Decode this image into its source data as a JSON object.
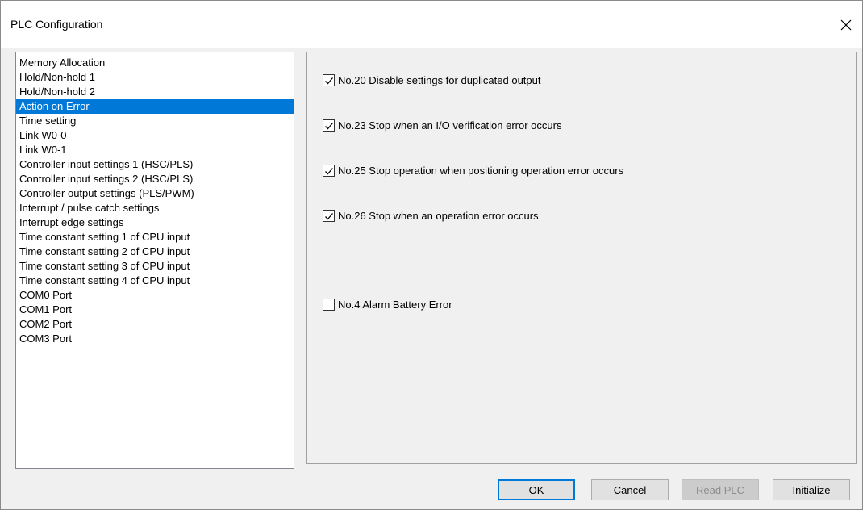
{
  "window": {
    "title": "PLC Configuration",
    "close_glyph": "close-icon"
  },
  "nav": {
    "items": [
      "Memory Allocation",
      "Hold/Non-hold 1",
      "Hold/Non-hold 2",
      "Action on Error",
      "Time setting",
      "Link W0-0",
      "Link W0-1",
      "Controller input settings 1 (HSC/PLS)",
      "Controller input settings 2 (HSC/PLS)",
      "Controller output settings (PLS/PWM)",
      "Interrupt / pulse catch settings",
      "Interrupt edge settings",
      "Time constant setting 1 of CPU input",
      "Time constant setting 2 of CPU input",
      "Time constant setting 3 of CPU input",
      "Time constant setting 4 of CPU input",
      "COM0 Port",
      "COM1 Port",
      "COM2 Port",
      "COM3 Port"
    ],
    "selected": "Action on Error"
  },
  "options": [
    {
      "label": "No.20 Disable settings for duplicated output",
      "checked": true
    },
    {
      "label": "No.23 Stop when an I/O verification error occurs",
      "checked": true
    },
    {
      "label": "No.25 Stop operation when positioning operation error occurs",
      "checked": true
    },
    {
      "label": "No.26 Stop when an operation error occurs",
      "checked": true
    },
    {
      "label": "No.4 Alarm Battery Error",
      "checked": false
    }
  ],
  "buttons": {
    "ok": "OK",
    "cancel": "Cancel",
    "read_plc": "Read PLC",
    "initialize": "Initialize"
  },
  "colors": {
    "selection": "#0078d7",
    "default_button_border": "#0078d7"
  }
}
